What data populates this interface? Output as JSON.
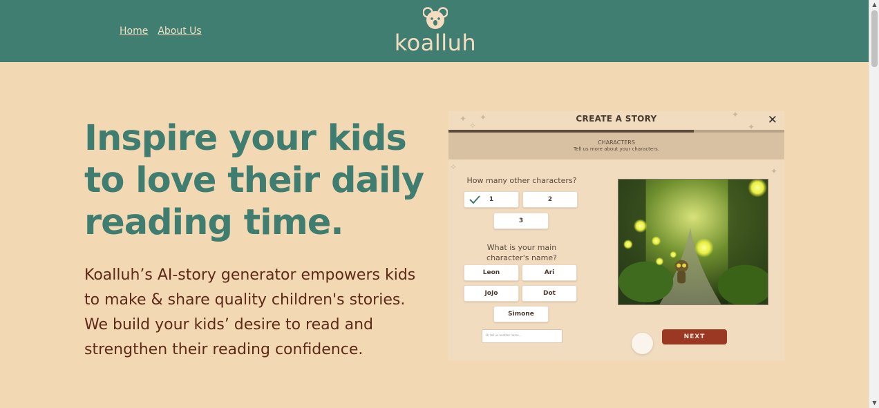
{
  "nav": {
    "home": "Home",
    "about": "About Us"
  },
  "logo": {
    "text": "koalluh",
    "icon": "koala-icon"
  },
  "hero": {
    "headline_line1": "Inspire your kids",
    "headline_line2": "to love their daily",
    "headline_line3": "reading time.",
    "body_line1": "Koalluh’s AI-story generator empowers kids",
    "body_line2": "to make & share quality children's stories.",
    "body_line3": "We build your kids’ desire to read and",
    "body_line4": "strengthen their reading confidence."
  },
  "preview": {
    "title": "CREATE A STORY",
    "close": "✕",
    "progress_fraction": 0.73,
    "step_title": "CHARACTERS",
    "step_sub": "Tell us more about your characters.",
    "question1": "How many other characters?",
    "count_options": [
      "1",
      "2",
      "3"
    ],
    "question2_line1": "What is your main",
    "question2_line2": "character's name?",
    "name_options": [
      "Leon",
      "Ari",
      "JoJo",
      "Dot",
      "Simone"
    ],
    "input_placeholder": "Or tell us another name...",
    "next_label": "NEXT"
  },
  "colors": {
    "header": "#3f7e71",
    "background": "#f2d8b3",
    "headline": "#3e7d70",
    "body_text": "#5c2a17",
    "next_button": "#9b3824"
  }
}
